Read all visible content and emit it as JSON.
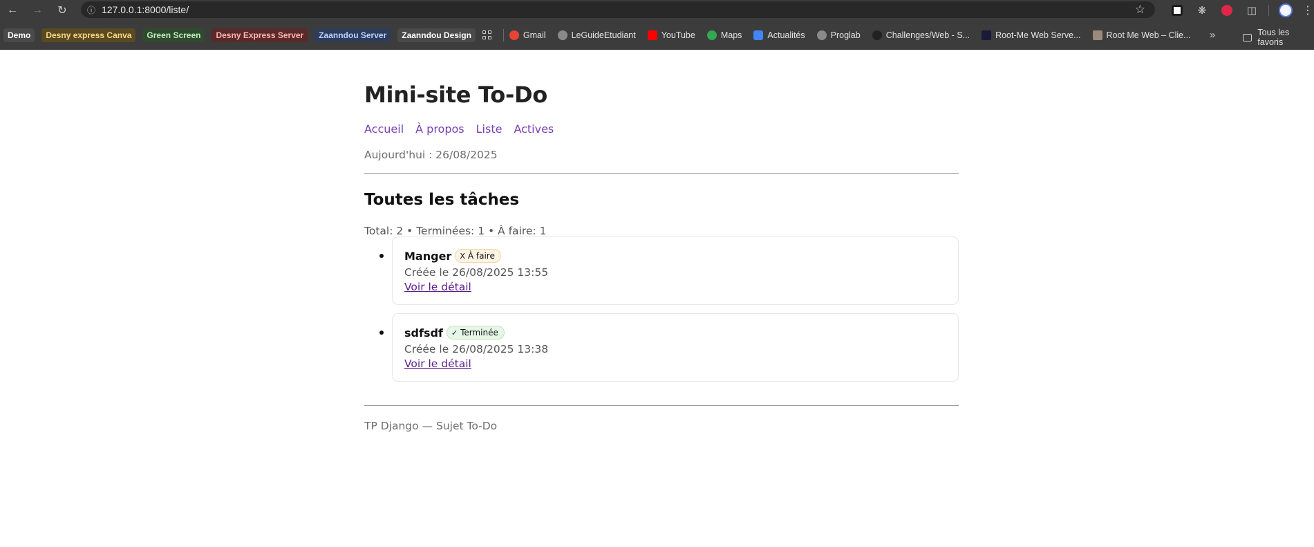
{
  "browser": {
    "url": "127.0.0.1:8000/liste/",
    "bookmarks_tags": [
      {
        "label": "Demo",
        "bg": "#4a4a4a",
        "fg": "#ffffff"
      },
      {
        "label": "Desny express Canva",
        "bg": "#5a4a20",
        "fg": "#f6d98a"
      },
      {
        "label": "Green Screen",
        "bg": "#2f4a2f",
        "fg": "#bff0b8"
      },
      {
        "label": "Desny Express Server",
        "bg": "#5a2a2a",
        "fg": "#ffb3b3"
      },
      {
        "label": "Zaanndou Server",
        "bg": "#2d3c5a",
        "fg": "#bcd2ff"
      },
      {
        "label": "Zaanndou Design",
        "bg": "#4a4a4a",
        "fg": "#ffffff"
      }
    ],
    "bookmarks": [
      {
        "label": "Gmail",
        "icon": "gmail-icon",
        "color": "#ea4335"
      },
      {
        "label": "LeGuideEtudiant",
        "icon": "globe-icon",
        "color": "#8a8a8a"
      },
      {
        "label": "YouTube",
        "icon": "youtube-icon",
        "color": "#ff0000"
      },
      {
        "label": "Maps",
        "icon": "maps-icon",
        "color": "#34a853"
      },
      {
        "label": "Actualités",
        "icon": "news-icon",
        "color": "#4285f4"
      },
      {
        "label": "Proglab",
        "icon": "globe-icon",
        "color": "#8a8a8a"
      },
      {
        "label": "Challenges/Web - S...",
        "icon": "rootme-icon",
        "color": "#222222"
      },
      {
        "label": "Root-Me Web Serve...",
        "icon": "rootme-icon",
        "color": "#1a1a3a"
      },
      {
        "label": "Root Me Web – Clie...",
        "icon": "image-icon",
        "color": "#9a8a7a"
      }
    ],
    "all_bookmarks": "Tous les favoris"
  },
  "site": {
    "title": "Mini-site To-Do",
    "nav": [
      "Accueil",
      "À propos",
      "Liste",
      "Actives"
    ],
    "today": "Aujourd'hui : 26/08/2025"
  },
  "main": {
    "heading": "Toutes les tâches",
    "stats": "Total: 2 • Terminées: 1 • À faire: 1",
    "tasks": [
      {
        "name": "Manger",
        "status_mark": "X",
        "status_label": "À faire",
        "created": "Créée le 26/08/2025 13:55",
        "link": "Voir le détail"
      },
      {
        "name": "sdfsdf",
        "status_mark": "✓",
        "status_label": "Terminée",
        "created": "Créée le 26/08/2025 13:38",
        "link": "Voir le détail"
      }
    ]
  },
  "footer": {
    "text": "TP Django — Sujet To-Do"
  }
}
